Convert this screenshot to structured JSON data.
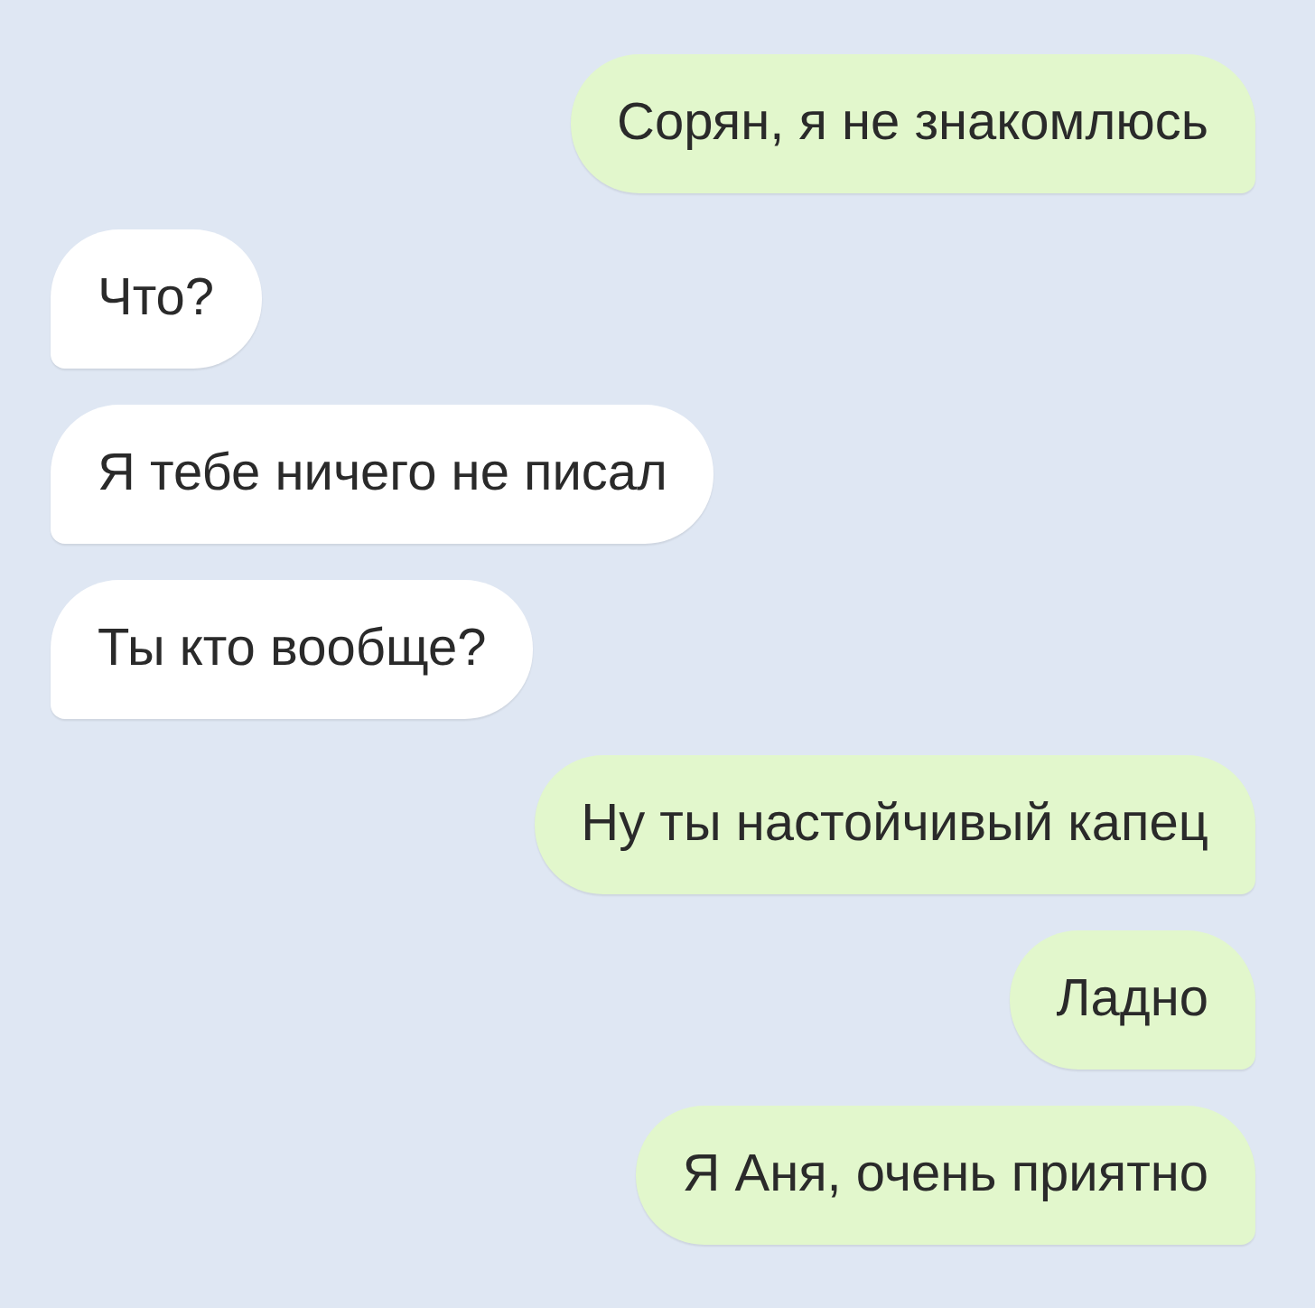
{
  "messages": [
    {
      "kind": "outgoing",
      "text": "Сорян, я не знакомлюсь"
    },
    {
      "kind": "incoming",
      "text": "Что?"
    },
    {
      "kind": "incoming",
      "text": "Я тебе ничего не писал"
    },
    {
      "kind": "incoming",
      "text": "Ты кто вообще?"
    },
    {
      "kind": "outgoing",
      "text": "Ну ты настойчивый капец"
    },
    {
      "kind": "outgoing",
      "text": "Ладно"
    },
    {
      "kind": "outgoing",
      "text": "Я Аня, очень приятно"
    }
  ]
}
